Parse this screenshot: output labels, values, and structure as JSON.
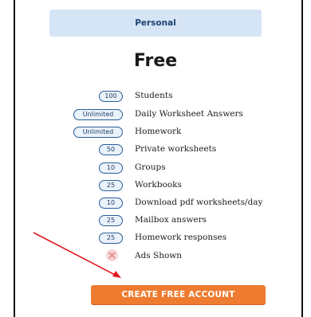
{
  "plan": {
    "tier_label": "Personal",
    "price_label": "Free"
  },
  "features": [
    {
      "badge": "100",
      "label": "Students"
    },
    {
      "badge": "Unlimited",
      "label": "Daily Worksheet Answers"
    },
    {
      "badge": "Unlimited",
      "label": "Homework"
    },
    {
      "badge": "50",
      "label": "Private worksheets"
    },
    {
      "badge": "10",
      "label": "Groups"
    },
    {
      "badge": "25",
      "label": "Workbooks"
    },
    {
      "badge": "10",
      "label": "Download pdf worksheets/day"
    },
    {
      "badge": "25",
      "label": "Mailbox answers"
    },
    {
      "badge": "25",
      "label": "Homework responses"
    },
    {
      "icon": "x-circle-icon",
      "label": "Ads Shown"
    }
  ],
  "cta": {
    "label": "CREATE FREE ACCOUNT"
  },
  "colors": {
    "tier_background": "#d6e5f5",
    "badge_border": "#2a5d95",
    "cta_background": "#ee7b2f",
    "arrow": "#e0191f"
  }
}
